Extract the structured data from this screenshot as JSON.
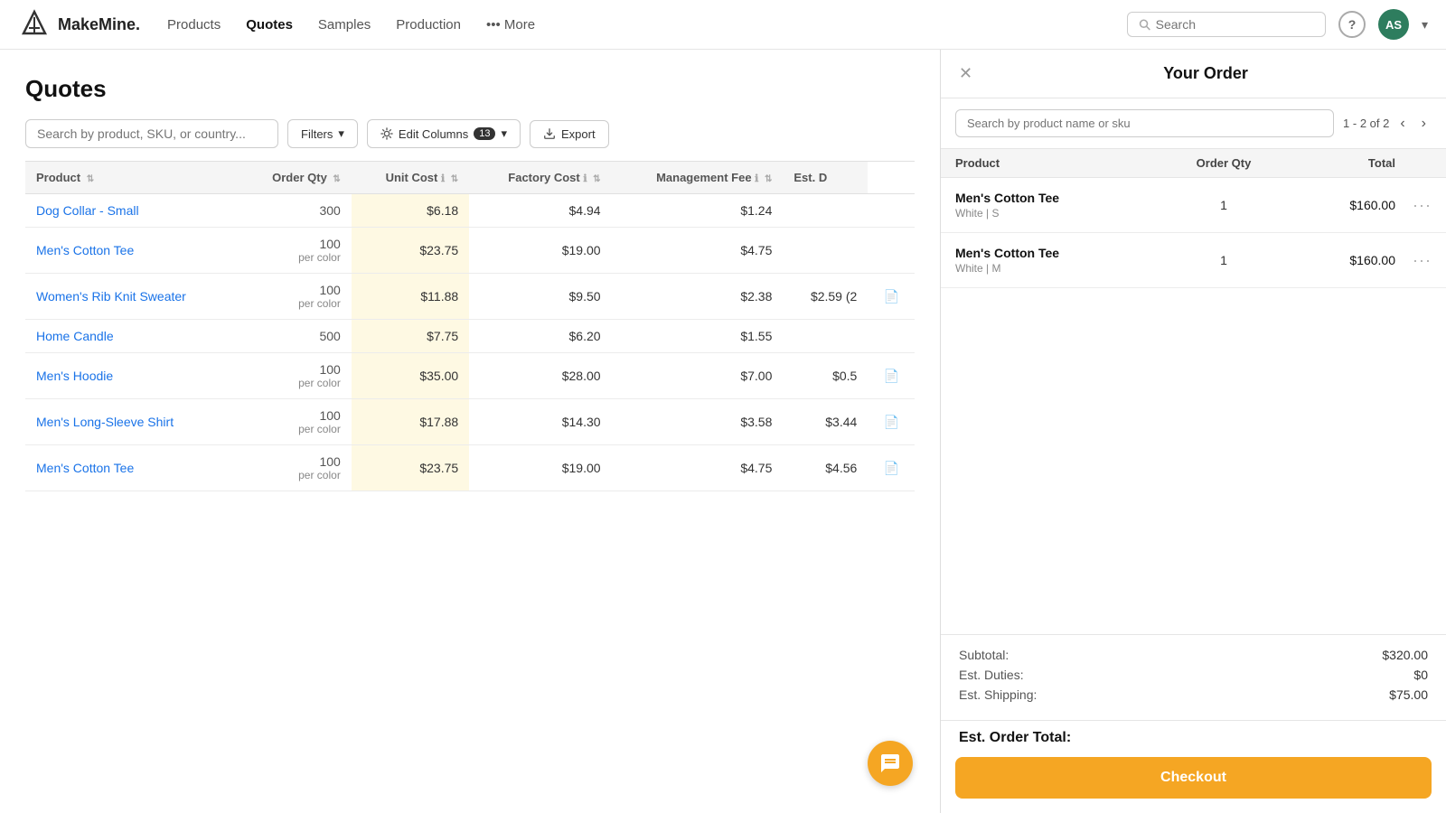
{
  "app": {
    "logo_text": "MakeMine.",
    "nav_items": [
      {
        "label": "Products",
        "active": false
      },
      {
        "label": "Quotes",
        "active": true
      },
      {
        "label": "Samples",
        "active": false
      },
      {
        "label": "Production",
        "active": false
      },
      {
        "label": "••• More",
        "active": false
      }
    ],
    "search_placeholder": "Search",
    "avatar_initials": "AS"
  },
  "quotes_page": {
    "title": "Quotes",
    "search_placeholder": "Search by product, SKU, or country...",
    "filters_label": "Filters",
    "edit_columns_label": "Edit Columns",
    "edit_columns_count": "13",
    "export_label": "Export",
    "table": {
      "columns": [
        "Product",
        "Order Qty",
        "Unit Cost",
        "Factory Cost",
        "Management Fee",
        "Est. D"
      ],
      "rows": [
        {
          "product": "Dog Collar - Small",
          "order_qty": "300",
          "per_color": false,
          "unit_cost": "$6.18",
          "factory_cost": "$4.94",
          "mgmt_fee": "$1.24",
          "est_d": "",
          "has_doc": false
        },
        {
          "product": "Men's Cotton Tee",
          "order_qty": "100",
          "per_color": true,
          "unit_cost": "$23.75",
          "factory_cost": "$19.00",
          "mgmt_fee": "$4.75",
          "est_d": "",
          "has_doc": false
        },
        {
          "product": "Women's Rib Knit Sweater",
          "order_qty": "100",
          "per_color": true,
          "unit_cost": "$11.88",
          "factory_cost": "$9.50",
          "mgmt_fee": "$2.38",
          "est_d": "$2.59 (2",
          "has_doc": true
        },
        {
          "product": "Home Candle",
          "order_qty": "500",
          "per_color": false,
          "unit_cost": "$7.75",
          "factory_cost": "$6.20",
          "mgmt_fee": "$1.55",
          "est_d": "",
          "has_doc": false
        },
        {
          "product": "Men's Hoodie",
          "order_qty": "100",
          "per_color": true,
          "unit_cost": "$35.00",
          "factory_cost": "$28.00",
          "mgmt_fee": "$7.00",
          "est_d": "$0.5",
          "has_doc": true
        },
        {
          "product": "Men's Long-Sleeve Shirt",
          "order_qty": "100",
          "per_color": true,
          "unit_cost": "$17.88",
          "factory_cost": "$14.30",
          "mgmt_fee": "$3.58",
          "est_d": "$3.44",
          "has_doc": true
        },
        {
          "product": "Men's Cotton Tee",
          "order_qty": "100",
          "per_color": true,
          "unit_cost": "$23.75",
          "factory_cost": "$19.00",
          "mgmt_fee": "$4.75",
          "est_d": "$4.56",
          "has_doc": true
        }
      ]
    }
  },
  "order_panel": {
    "title": "Your Order",
    "search_placeholder": "Search by product name or sku",
    "pagination": "1 - 2 of 2",
    "columns": [
      "Product",
      "Order Qty",
      "Total"
    ],
    "items": [
      {
        "name": "Men's Cotton Tee",
        "variant": "White | S",
        "qty": "1",
        "total": "$160.00"
      },
      {
        "name": "Men's Cotton Tee",
        "variant": "White | M",
        "qty": "1",
        "total": "$160.00"
      }
    ],
    "subtotal_label": "Subtotal:",
    "subtotal_value": "$320.00",
    "duties_label": "Est. Duties:",
    "duties_value": "$0",
    "shipping_label": "Est. Shipping:",
    "shipping_value": "$75.00",
    "est_total_label": "Est. Order Total:",
    "est_total_value": "",
    "checkout_label": "Checkout"
  }
}
